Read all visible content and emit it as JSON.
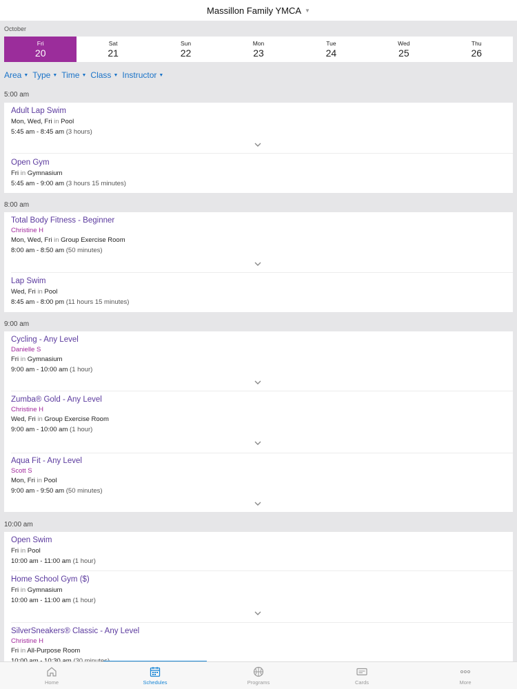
{
  "header": {
    "title": "Massillon Family YMCA"
  },
  "calendar": {
    "month": "October",
    "days": [
      {
        "name": "Fri",
        "date": "20",
        "selected": true
      },
      {
        "name": "Sat",
        "date": "21"
      },
      {
        "name": "Sun",
        "date": "22"
      },
      {
        "name": "Mon",
        "date": "23"
      },
      {
        "name": "Tue",
        "date": "24"
      },
      {
        "name": "Wed",
        "date": "25"
      },
      {
        "name": "Thu",
        "date": "26"
      }
    ]
  },
  "filters": [
    "Area",
    "Type",
    "Time",
    "Class",
    "Instructor"
  ],
  "schedule": [
    {
      "time": "5:00 am",
      "classes": [
        {
          "name": "Adult Lap Swim",
          "days": "Mon, Wed, Fri",
          "in": "in",
          "location": "Pool",
          "time": "5:45 am - 8:45 am",
          "duration": "(3 hours)"
        },
        {
          "name": "Open Gym",
          "days": "Fri",
          "in": "in",
          "location": "Gymnasium",
          "time": "5:45 am - 9:00 am",
          "duration": "(3 hours 15 minutes)"
        }
      ]
    },
    {
      "time": "8:00 am",
      "classes": [
        {
          "name": "Total Body Fitness - Beginner",
          "instructor": "Christine H",
          "days": "Mon, Wed, Fri",
          "in": "in",
          "location": "Group Exercise Room",
          "time": "8:00 am - 8:50 am",
          "duration": "(50 minutes)"
        },
        {
          "name": "Lap Swim",
          "days": "Wed, Fri",
          "in": "in",
          "location": "Pool",
          "time": "8:45 am - 8:00 pm",
          "duration": "(11 hours 15 minutes)"
        }
      ]
    },
    {
      "time": "9:00 am",
      "classes": [
        {
          "name": "Cycling - Any Level",
          "instructor": "Danielle S",
          "days": "Fri",
          "in": "in",
          "location": "Gymnasium",
          "time": "9:00 am - 10:00 am",
          "duration": "(1 hour)"
        },
        {
          "name": "Zumba® Gold - Any Level",
          "instructor": "Christine H",
          "days": "Wed, Fri",
          "in": "in",
          "location": "Group Exercise Room",
          "time": "9:00 am - 10:00 am",
          "duration": "(1 hour)"
        },
        {
          "name": "Aqua Fit - Any Level",
          "instructor": "Scott S",
          "days": "Mon, Fri",
          "in": "in",
          "location": "Pool",
          "time": "9:00 am - 9:50 am",
          "duration": "(50 minutes)"
        }
      ]
    },
    {
      "time": "10:00 am",
      "classes": [
        {
          "name": "Open Swim",
          "days": "Fri",
          "in": "in",
          "location": "Pool",
          "time": "10:00 am - 11:00 am",
          "duration": "(1 hour)"
        },
        {
          "name": "Home School Gym ($)",
          "days": "Fri",
          "in": "in",
          "location": "Gymnasium",
          "time": "10:00 am - 11:00 am",
          "duration": "(1 hour)"
        },
        {
          "name": "SilverSneakers® Classic - Any Level",
          "instructor": "Christine H",
          "days": "Fri",
          "in": "in",
          "location": "All-Purpose Room",
          "time": "10:00 am - 10:30 am",
          "duration": "(30 minutes)"
        }
      ]
    }
  ],
  "tabs": [
    {
      "label": "Home",
      "icon": "home-icon"
    },
    {
      "label": "Schedules",
      "icon": "calendar-icon",
      "active": true
    },
    {
      "label": "Programs",
      "icon": "basketball-icon"
    },
    {
      "label": "Cards",
      "icon": "card-icon"
    },
    {
      "label": "More",
      "icon": "more-icon"
    }
  ],
  "colors": {
    "accent": "#9b2d9b",
    "link": "#1a73c8",
    "className": "#5b3a9e",
    "instructor": "#a0269a",
    "tabActive": "#1a87d6"
  }
}
